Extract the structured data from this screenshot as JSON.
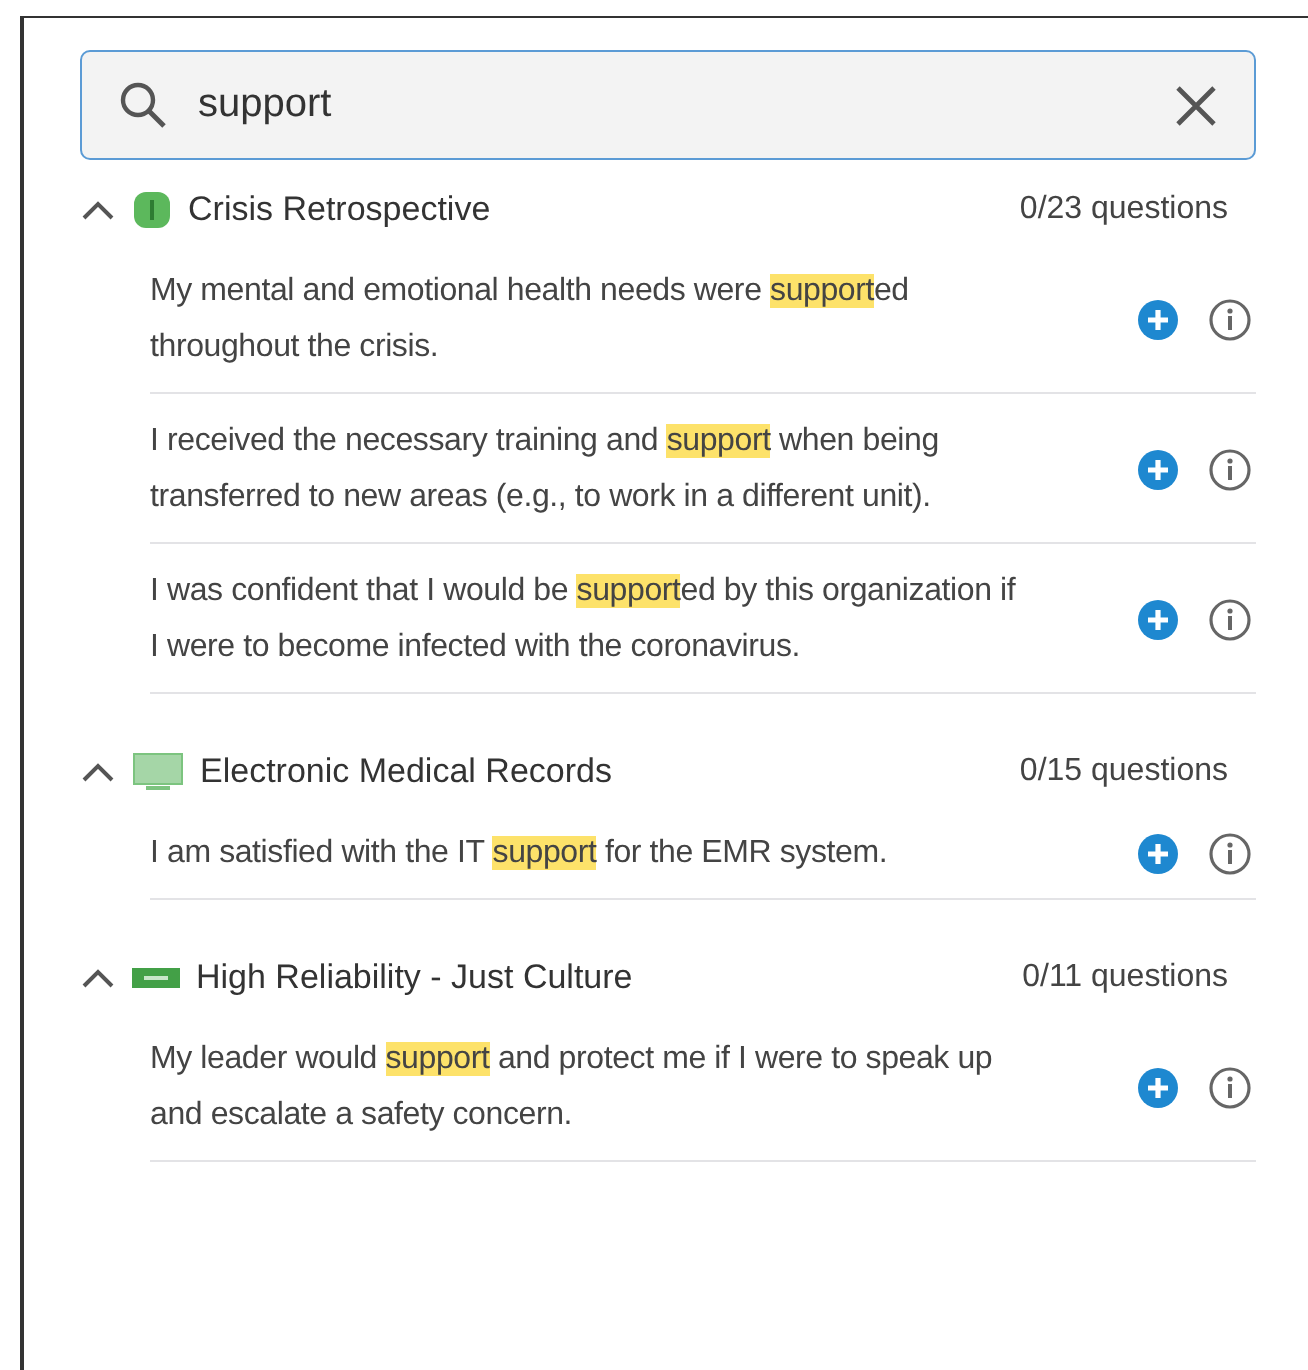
{
  "search": {
    "value": "support"
  },
  "groups": [
    {
      "title": "Crisis Retrospective",
      "kind": "alert",
      "count": "0/23 questions",
      "expanded": true,
      "questions": [
        {
          "segments": [
            {
              "text": "My mental and emotional health needs were ",
              "highlighted": false
            },
            {
              "text": "support",
              "highlighted": true
            },
            {
              "text": "ed throughout the crisis.",
              "highlighted": false
            }
          ]
        },
        {
          "segments": [
            {
              "text": "I received the necessary training and ",
              "highlighted": false
            },
            {
              "text": "support",
              "highlighted": true
            },
            {
              "text": " when being transferred to new areas (e.g., to work in a different unit).",
              "highlighted": false
            }
          ]
        },
        {
          "segments": [
            {
              "text": "I was confident that I would be ",
              "highlighted": false
            },
            {
              "text": "support",
              "highlighted": true
            },
            {
              "text": "ed by this organization if I were to become infected with the coronavirus.",
              "highlighted": false
            }
          ]
        }
      ]
    },
    {
      "title": "Electronic Medical Records",
      "kind": "monitor",
      "count": "0/15 questions",
      "expanded": true,
      "questions": [
        {
          "segments": [
            {
              "text": "I am satisfied with the IT ",
              "highlighted": false
            },
            {
              "text": "support",
              "highlighted": true
            },
            {
              "text": " for the EMR system.",
              "highlighted": false
            }
          ]
        }
      ]
    },
    {
      "title": "High Reliability - Just Culture",
      "kind": "badge",
      "count": "0/11 questions",
      "expanded": true,
      "questions": [
        {
          "segments": [
            {
              "text": "My leader would ",
              "highlighted": false
            },
            {
              "text": "support",
              "highlighted": true
            },
            {
              "text": " and protect me if I were to speak up and escalate a safety concern.",
              "highlighted": false
            }
          ]
        }
      ]
    }
  ]
}
